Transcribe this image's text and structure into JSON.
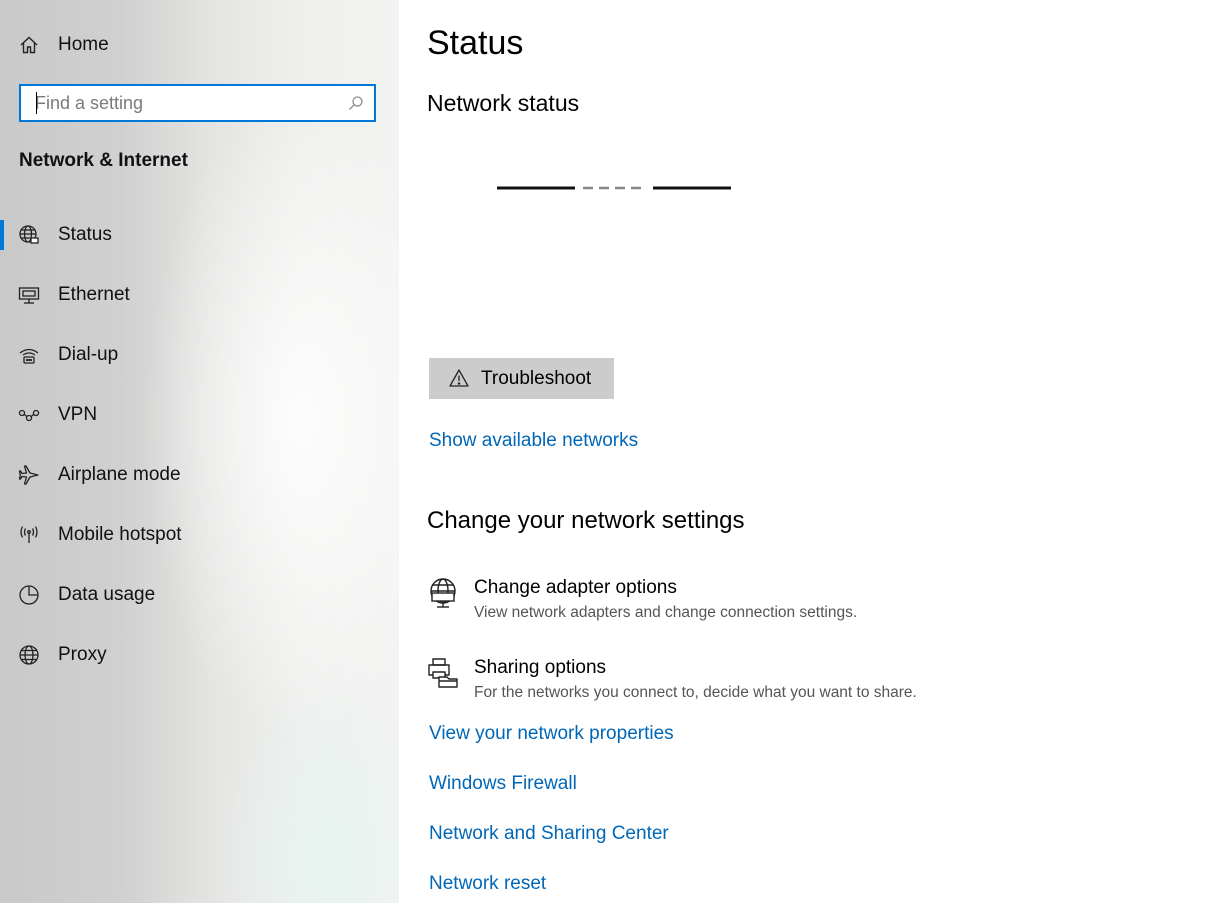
{
  "sidebar": {
    "home_label": "Home",
    "search": {
      "placeholder": "Find a setting",
      "value": ""
    },
    "section_title": "Network & Internet",
    "active_item": "Status",
    "accent_color": "#0078d7",
    "items": [
      {
        "label": "Status",
        "icon": "globe-status-icon"
      },
      {
        "label": "Ethernet",
        "icon": "ethernet-icon"
      },
      {
        "label": "Dial-up",
        "icon": "dialup-icon"
      },
      {
        "label": "VPN",
        "icon": "vpn-icon"
      },
      {
        "label": "Airplane mode",
        "icon": "airplane-icon"
      },
      {
        "label": "Mobile hotspot",
        "icon": "hotspot-icon"
      },
      {
        "label": "Data usage",
        "icon": "data-usage-icon"
      },
      {
        "label": "Proxy",
        "icon": "globe-icon"
      }
    ]
  },
  "main": {
    "title": "Status",
    "network_status_heading": "Network status",
    "troubleshoot_label": "Troubleshoot",
    "show_networks_link": "Show available networks",
    "change_heading": "Change your network settings",
    "options": [
      {
        "title": "Change adapter options",
        "desc": "View network adapters and change connection settings.",
        "icon": "adapter-icon"
      },
      {
        "title": "Sharing options",
        "desc": "For the networks you connect to, decide what you want to share.",
        "icon": "sharing-icon"
      }
    ],
    "links": [
      "View your network properties",
      "Windows Firewall",
      "Network and Sharing Center",
      "Network reset"
    ],
    "link_color": "#0067b8"
  }
}
